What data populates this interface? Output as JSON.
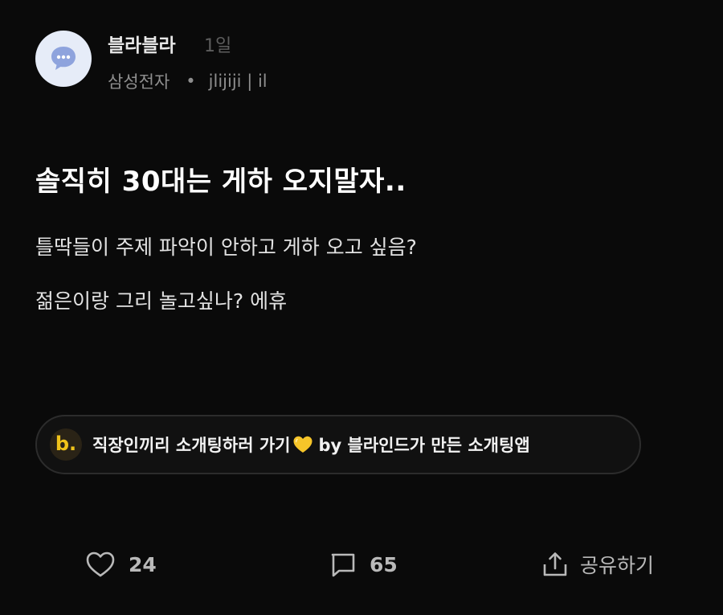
{
  "author": {
    "name": "블라블라",
    "time": "1일",
    "company": "삼성전자",
    "separator": "•",
    "handle": "jlijiji | il",
    "avatar_icon": "chat-bubble-icon"
  },
  "post": {
    "title": "솔직히 30대는 게하 오지말자..",
    "lines": [
      "틀딱들이 주제 파악이 안하고 게하 오고 싶음?",
      "젊은이랑 그리 놀고싶나? 에휴"
    ]
  },
  "ad": {
    "logo_letter": "b.",
    "text_before": "직장인끼리 소개팅하러 가기",
    "emoji_icon": "yellow-heart-icon",
    "text_after": "by 블라인드가 만든 소개팅앱",
    "accent_color": "#f0c31a"
  },
  "actions": {
    "like_icon": "heart-outline-icon",
    "like_count": "24",
    "comment_icon": "comment-icon",
    "comment_count": "65",
    "share_icon": "share-icon",
    "share_label": "공유하기"
  }
}
